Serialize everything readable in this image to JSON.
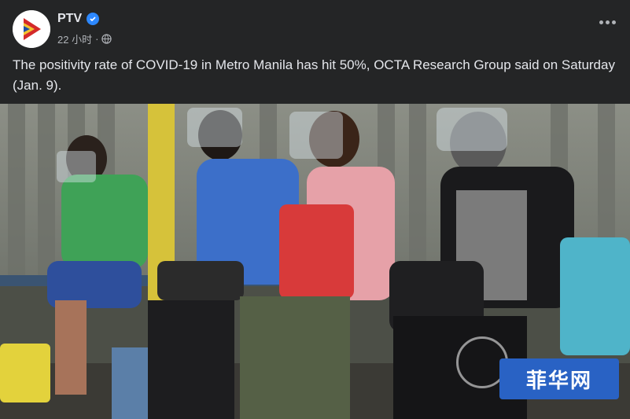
{
  "post": {
    "page_name": "PTV",
    "timestamp": "22 小时",
    "separator": "·",
    "text": "The positivity rate of COVID-19 in Metro Manila has hit 50%, OCTA Research Group said on Saturday (Jan. 9)."
  },
  "icons": {
    "verified": "verified-badge-icon",
    "audience": "globe-icon",
    "more": "more-options-icon"
  },
  "watermark": {
    "text": "菲华网"
  },
  "colors": {
    "background": "#242526",
    "text_primary": "#e4e6eb",
    "text_secondary": "#b0b3b8",
    "verified_blue": "#2d88ff",
    "watermark_blue": "#2962c4"
  }
}
